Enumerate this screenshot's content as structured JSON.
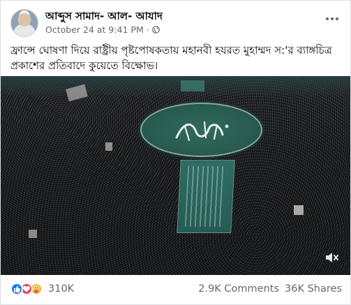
{
  "post": {
    "author": "আব্দুস সামাদ- আল- আযাদ",
    "timestamp": "October 24 at 9:41 PM",
    "separator": "·",
    "text": "ফ্রান্সে ঘোষণা দিয়ে রাষ্ট্রীয় পৃষ্টপোষকতায় মহানবী হযরত মুহাম্মদ স:'র ব্যাঙ্গচিত্র প্রকাশের প্রতিবাদে কুয়েতে বিক্ষোভ।"
  },
  "video": {
    "description_icon": "mute-icon"
  },
  "footer": {
    "reaction_count": "310K",
    "comments": "2.9K Comments",
    "shares": "36K Shares",
    "reaction_icons": [
      "like-icon",
      "love-icon",
      "care-icon"
    ]
  },
  "colors": {
    "like": "#1877f2",
    "love": "#f33e58",
    "care": "#f7b125",
    "meta_text": "#65676b"
  }
}
